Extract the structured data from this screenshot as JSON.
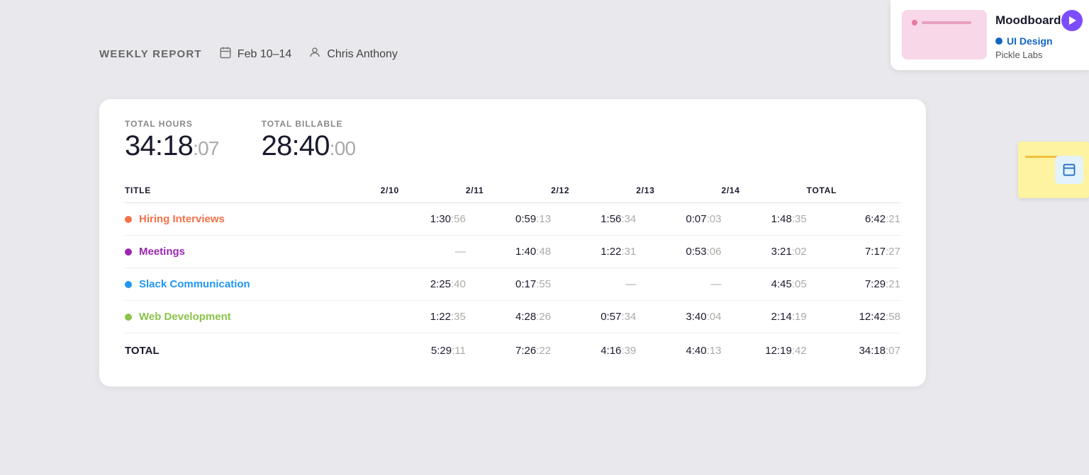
{
  "header": {
    "report_label": "WEEKLY REPORT",
    "date_range": "Feb 10–14",
    "user_name": "Chris Anthony"
  },
  "totals": {
    "total_hours_label": "TOTAL HOURS",
    "total_hours_main": "34:18",
    "total_hours_sec": ":07",
    "total_billable_label": "TOTAL BILLABLE",
    "total_billable_main": "28:40",
    "total_billable_sec": ":00"
  },
  "table": {
    "columns": [
      "TITLE",
      "2/10",
      "2/11",
      "2/12",
      "2/13",
      "2/14",
      "TOTAL"
    ],
    "rows": [
      {
        "name": "Hiring Interviews",
        "color": "#f4724a",
        "d10": {
          "main": "1:30",
          "sec": ":56"
        },
        "d11": {
          "main": "0:59",
          "sec": ":13"
        },
        "d12": {
          "main": "1:56",
          "sec": ":34"
        },
        "d13": {
          "main": "0:07",
          "sec": ":03"
        },
        "d14": {
          "main": "1:48",
          "sec": ":35"
        },
        "total": {
          "main": "6:42",
          "sec": ":21"
        }
      },
      {
        "name": "Meetings",
        "color": "#9c27b0",
        "d10": {
          "main": "—",
          "sec": ""
        },
        "d11": {
          "main": "1:40",
          "sec": ":48"
        },
        "d12": {
          "main": "1:22",
          "sec": ":31"
        },
        "d13": {
          "main": "0:53",
          "sec": ":06"
        },
        "d14": {
          "main": "3:21",
          "sec": ":02"
        },
        "total": {
          "main": "7:17",
          "sec": ":27"
        }
      },
      {
        "name": "Slack Communication",
        "color": "#2196f3",
        "d10": {
          "main": "2:25",
          "sec": ":40"
        },
        "d11": {
          "main": "0:17",
          "sec": ":55"
        },
        "d12": {
          "main": "—",
          "sec": ""
        },
        "d13": {
          "main": "—",
          "sec": ""
        },
        "d14": {
          "main": "4:45",
          "sec": ":05"
        },
        "total": {
          "main": "7:29",
          "sec": ":21"
        }
      },
      {
        "name": "Web Development",
        "color": "#8bc34a",
        "d10": {
          "main": "1:22",
          "sec": ":35"
        },
        "d11": {
          "main": "4:28",
          "sec": ":26"
        },
        "d12": {
          "main": "0:57",
          "sec": ":34"
        },
        "d13": {
          "main": "3:40",
          "sec": ":04"
        },
        "d14": {
          "main": "2:14",
          "sec": ":19"
        },
        "total": {
          "main": "12:42",
          "sec": ":58"
        }
      }
    ],
    "totals_row": {
      "label": "TOTAL",
      "d10": {
        "main": "5:29",
        "sec": ":11"
      },
      "d11": {
        "main": "7:26",
        "sec": ":22"
      },
      "d12": {
        "main": "4:16",
        "sec": ":39"
      },
      "d13": {
        "main": "4:40",
        "sec": ":13"
      },
      "d14": {
        "main": "12:19",
        "sec": ":42"
      },
      "total": {
        "main": "34:18",
        "sec": ":07"
      }
    }
  },
  "moodboard": {
    "title": "Moodboard",
    "tag": "UI Design",
    "subtitle": "Pickle Labs"
  },
  "colors": {
    "accent_purple": "#7c4dff",
    "accent_blue": "#1565c0"
  }
}
